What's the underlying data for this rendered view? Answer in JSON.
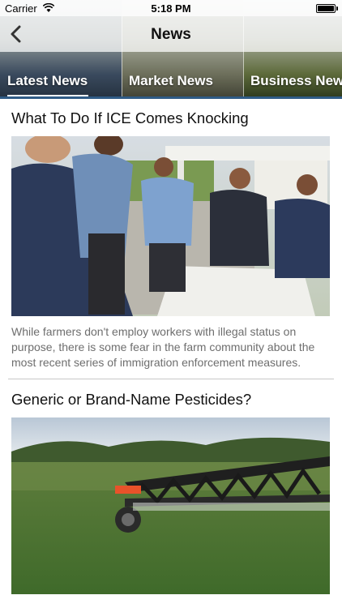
{
  "status_bar": {
    "carrier": "Carrier",
    "time": "5:18 PM",
    "battery_level": 1.0
  },
  "nav": {
    "title": "News",
    "back_icon": "chevron-left-icon"
  },
  "tabs": [
    {
      "label": "Latest News",
      "active": true
    },
    {
      "label": "Market News",
      "active": false
    },
    {
      "label": "Business News",
      "active": false
    }
  ],
  "articles": [
    {
      "title": "What To Do If ICE Comes Knocking",
      "summary": "While farmers don't employ workers with illegal status on purpose, there is some fear in the farm community about the most recent series of immigration enforcement measures."
    },
    {
      "title": "Generic or Brand-Name Pesticides?",
      "summary": ""
    }
  ],
  "colors": {
    "tab_indicator": "#2f5b86",
    "summary_text": "#6e6e6e",
    "separator": "#c8c8c8"
  }
}
